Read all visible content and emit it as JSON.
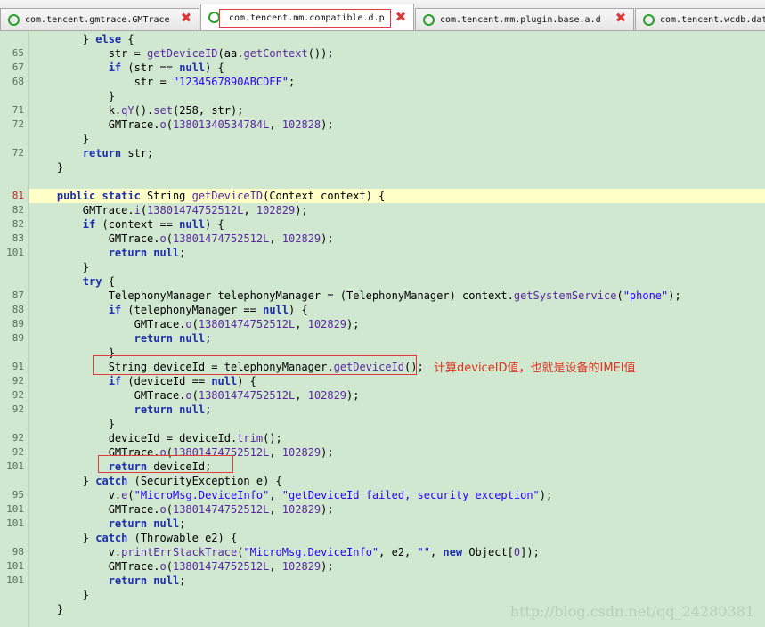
{
  "tabs": [
    {
      "label": "com.tencent.gmtrace.GMTrace",
      "active": false
    },
    {
      "label": "com.tencent.mm.compatible.d.p",
      "active": true
    },
    {
      "label": "com.tencent.mm.plugin.base.a.d",
      "active": false
    },
    {
      "label": "com.tencent.wcdb.dat",
      "active": false
    }
  ],
  "annotation": "计算deviceID值，也就是设备的IMEI值",
  "watermark": "http://blog.csdn.net/qq_24280381",
  "lines": [
    {
      "n": "",
      "segs": [
        [
          "",
          "        } "
        ],
        [
          "k",
          "else"
        ],
        [
          "",
          " {"
        ]
      ]
    },
    {
      "n": "65",
      "segs": [
        [
          "",
          "            str = "
        ],
        [
          "f",
          "getDeviceID"
        ],
        [
          "",
          "(aa."
        ],
        [
          "f",
          "getContext"
        ],
        [
          "",
          "());"
        ]
      ]
    },
    {
      "n": "67",
      "segs": [
        [
          "",
          "            "
        ],
        [
          "k",
          "if"
        ],
        [
          "",
          " (str == "
        ],
        [
          "k",
          "null"
        ],
        [
          "",
          ") {"
        ]
      ]
    },
    {
      "n": "68",
      "segs": [
        [
          "",
          "                str = "
        ],
        [
          "s",
          "\"1234567890ABCDEF\""
        ],
        [
          "",
          ";"
        ]
      ]
    },
    {
      "n": "",
      "segs": [
        [
          "",
          "            }"
        ]
      ]
    },
    {
      "n": "71",
      "segs": [
        [
          "",
          "            k."
        ],
        [
          "f",
          "qY"
        ],
        [
          "",
          "()."
        ],
        [
          "f",
          "set"
        ],
        [
          "",
          "(258, str);"
        ]
      ]
    },
    {
      "n": "72",
      "segs": [
        [
          "",
          "            GMTrace."
        ],
        [
          "f",
          "o"
        ],
        [
          "",
          "("
        ],
        [
          "f",
          "13801340534784L"
        ],
        [
          "",
          ", "
        ],
        [
          "f",
          "102828"
        ],
        [
          "",
          ");"
        ]
      ]
    },
    {
      "n": "",
      "segs": [
        [
          "",
          "        }"
        ]
      ]
    },
    {
      "n": "72",
      "segs": [
        [
          "",
          "        "
        ],
        [
          "k",
          "return"
        ],
        [
          "",
          " str;"
        ]
      ]
    },
    {
      "n": "",
      "segs": [
        [
          "",
          "    }"
        ]
      ]
    },
    {
      "n": "",
      "segs": [
        [
          "",
          ""
        ]
      ]
    },
    {
      "n": "81",
      "cur": true,
      "hl": true,
      "segs": [
        [
          "",
          "    "
        ],
        [
          "k",
          "public static"
        ],
        [
          "",
          " String "
        ],
        [
          "f",
          "getDeviceID"
        ],
        [
          "",
          "(Context context) {"
        ]
      ]
    },
    {
      "n": "82",
      "segs": [
        [
          "",
          "        GMTrace."
        ],
        [
          "f",
          "i"
        ],
        [
          "",
          "("
        ],
        [
          "f",
          "13801474752512L"
        ],
        [
          "",
          ", "
        ],
        [
          "f",
          "102829"
        ],
        [
          "",
          ");"
        ]
      ]
    },
    {
      "n": "82",
      "segs": [
        [
          "",
          "        "
        ],
        [
          "k",
          "if"
        ],
        [
          "",
          " (context == "
        ],
        [
          "k",
          "null"
        ],
        [
          "",
          ") {"
        ]
      ]
    },
    {
      "n": "83",
      "segs": [
        [
          "",
          "            GMTrace."
        ],
        [
          "f",
          "o"
        ],
        [
          "",
          "("
        ],
        [
          "f",
          "13801474752512L"
        ],
        [
          "",
          ", "
        ],
        [
          "f",
          "102829"
        ],
        [
          "",
          ");"
        ]
      ]
    },
    {
      "n": "101",
      "segs": [
        [
          "",
          "            "
        ],
        [
          "k",
          "return null"
        ],
        [
          "",
          ";"
        ]
      ]
    },
    {
      "n": "",
      "segs": [
        [
          "",
          "        }"
        ]
      ]
    },
    {
      "n": "",
      "segs": [
        [
          "",
          "        "
        ],
        [
          "k",
          "try"
        ],
        [
          "",
          " {"
        ]
      ]
    },
    {
      "n": "87",
      "segs": [
        [
          "",
          "            TelephonyManager telephonyManager = (TelephonyManager) context."
        ],
        [
          "f",
          "getSystemService"
        ],
        [
          "",
          "("
        ],
        [
          "s",
          "\"phone\""
        ],
        [
          "",
          ");"
        ]
      ]
    },
    {
      "n": "88",
      "segs": [
        [
          "",
          "            "
        ],
        [
          "k",
          "if"
        ],
        [
          "",
          " (telephonyManager == "
        ],
        [
          "k",
          "null"
        ],
        [
          "",
          ") {"
        ]
      ]
    },
    {
      "n": "89",
      "segs": [
        [
          "",
          "                GMTrace."
        ],
        [
          "f",
          "o"
        ],
        [
          "",
          "("
        ],
        [
          "f",
          "13801474752512L"
        ],
        [
          "",
          ", "
        ],
        [
          "f",
          "102829"
        ],
        [
          "",
          ");"
        ]
      ]
    },
    {
      "n": "89",
      "segs": [
        [
          "",
          "                "
        ],
        [
          "k",
          "return null"
        ],
        [
          "",
          ";"
        ]
      ]
    },
    {
      "n": "",
      "segs": [
        [
          "",
          "            }"
        ]
      ]
    },
    {
      "n": "91",
      "segs": [
        [
          "",
          "            String deviceId = telephonyManager."
        ],
        [
          "f",
          "getDeviceId"
        ],
        [
          "",
          "();"
        ]
      ]
    },
    {
      "n": "92",
      "segs": [
        [
          "",
          "            "
        ],
        [
          "k",
          "if"
        ],
        [
          "",
          " (deviceId == "
        ],
        [
          "k",
          "null"
        ],
        [
          "",
          ") {"
        ]
      ]
    },
    {
      "n": "92",
      "segs": [
        [
          "",
          "                GMTrace."
        ],
        [
          "f",
          "o"
        ],
        [
          "",
          "("
        ],
        [
          "f",
          "13801474752512L"
        ],
        [
          "",
          ", "
        ],
        [
          "f",
          "102829"
        ],
        [
          "",
          ");"
        ]
      ]
    },
    {
      "n": "92",
      "segs": [
        [
          "",
          "                "
        ],
        [
          "k",
          "return null"
        ],
        [
          "",
          ";"
        ]
      ]
    },
    {
      "n": "",
      "segs": [
        [
          "",
          "            }"
        ]
      ]
    },
    {
      "n": "92",
      "segs": [
        [
          "",
          "            deviceId = deviceId."
        ],
        [
          "f",
          "trim"
        ],
        [
          "",
          "();"
        ]
      ]
    },
    {
      "n": "92",
      "segs": [
        [
          "",
          "            GMTrace."
        ],
        [
          "f",
          "o"
        ],
        [
          "",
          "("
        ],
        [
          "f",
          "13801474752512L"
        ],
        [
          "",
          ", "
        ],
        [
          "f",
          "102829"
        ],
        [
          "",
          ");"
        ]
      ]
    },
    {
      "n": "101",
      "segs": [
        [
          "",
          "            "
        ],
        [
          "k",
          "return"
        ],
        [
          "",
          " deviceId;"
        ]
      ]
    },
    {
      "n": "",
      "segs": [
        [
          "",
          "        } "
        ],
        [
          "k",
          "catch"
        ],
        [
          "",
          " (SecurityException e) {"
        ]
      ]
    },
    {
      "n": "95",
      "segs": [
        [
          "",
          "            v."
        ],
        [
          "f",
          "e"
        ],
        [
          "",
          "("
        ],
        [
          "s",
          "\"MicroMsg.DeviceInfo\""
        ],
        [
          "",
          ", "
        ],
        [
          "s",
          "\"getDeviceId failed, security exception\""
        ],
        [
          "",
          ");"
        ]
      ]
    },
    {
      "n": "101",
      "segs": [
        [
          "",
          "            GMTrace."
        ],
        [
          "f",
          "o"
        ],
        [
          "",
          "("
        ],
        [
          "f",
          "13801474752512L"
        ],
        [
          "",
          ", "
        ],
        [
          "f",
          "102829"
        ],
        [
          "",
          ");"
        ]
      ]
    },
    {
      "n": "101",
      "segs": [
        [
          "",
          "            "
        ],
        [
          "k",
          "return null"
        ],
        [
          "",
          ";"
        ]
      ]
    },
    {
      "n": "",
      "segs": [
        [
          "",
          "        } "
        ],
        [
          "k",
          "catch"
        ],
        [
          "",
          " (Throwable e2) {"
        ]
      ]
    },
    {
      "n": "98",
      "segs": [
        [
          "",
          "            v."
        ],
        [
          "f",
          "printErrStackTrace"
        ],
        [
          "",
          "("
        ],
        [
          "s",
          "\"MicroMsg.DeviceInfo\""
        ],
        [
          "",
          ", e2, "
        ],
        [
          "s",
          "\"\""
        ],
        [
          "",
          ", "
        ],
        [
          "k",
          "new"
        ],
        [
          "",
          " Object["
        ],
        [
          "f",
          "0"
        ],
        [
          "",
          "]);"
        ]
      ]
    },
    {
      "n": "101",
      "segs": [
        [
          "",
          "            GMTrace."
        ],
        [
          "f",
          "o"
        ],
        [
          "",
          "("
        ],
        [
          "f",
          "13801474752512L"
        ],
        [
          "",
          ", "
        ],
        [
          "f",
          "102829"
        ],
        [
          "",
          ");"
        ]
      ]
    },
    {
      "n": "101",
      "segs": [
        [
          "",
          "            "
        ],
        [
          "k",
          "return null"
        ],
        [
          "",
          ";"
        ]
      ]
    },
    {
      "n": "",
      "segs": [
        [
          "",
          "        }"
        ]
      ]
    },
    {
      "n": "",
      "segs": [
        [
          "",
          "    }"
        ]
      ]
    }
  ]
}
